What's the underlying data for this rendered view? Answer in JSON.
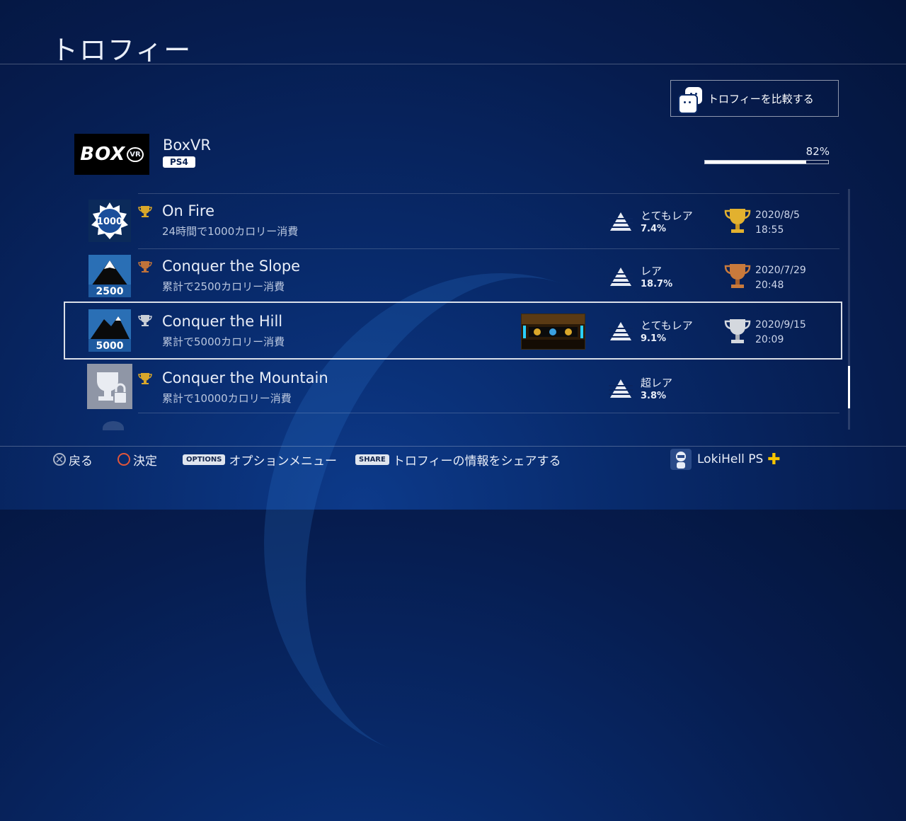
{
  "header": {
    "title": "トロフィー"
  },
  "compare_button": {
    "label": "トロフィーを比較する"
  },
  "game": {
    "logo_text": "BOX",
    "logo_badge": "VR",
    "title": "BoxVR",
    "platform": "PS4",
    "progress_text": "82%",
    "progress": 0.82
  },
  "trophies": [
    {
      "badge": "1000",
      "name": "On Fire",
      "description": "24時間で1000カロリー消費",
      "grade": "gold",
      "rarity_label": "とてもレア",
      "rarity_pct": "7.4%",
      "date": "2020/8/5",
      "time": "18:55",
      "earned": true
    },
    {
      "badge": "2500",
      "name": "Conquer the Slope",
      "description": "累計で2500カロリー消費",
      "grade": "bronze",
      "rarity_label": "レア",
      "rarity_pct": "18.7%",
      "date": "2020/7/29",
      "time": "20:48",
      "earned": true
    },
    {
      "badge": "5000",
      "name": "Conquer the Hill",
      "description": "累計で5000カロリー消費",
      "grade": "silver",
      "rarity_label": "とてもレア",
      "rarity_pct": "9.1%",
      "date": "2020/9/15",
      "time": "20:09",
      "earned": true,
      "selected": true
    },
    {
      "badge": "",
      "name": "Conquer the Mountain",
      "description": "累計で10000カロリー消費",
      "grade": "gold",
      "rarity_label": "超レア",
      "rarity_pct": "3.8%",
      "date": "",
      "time": "",
      "earned": false
    }
  ],
  "footer": {
    "back_label": "戻る",
    "confirm_label": "決定",
    "options_key": "OPTIONS",
    "options_label": "オプションメニュー",
    "share_key": "SHARE",
    "share_label": "トロフィーの情報をシェアする",
    "user_name": "LokiHell PS",
    "plus_icon": "✚"
  },
  "colors": {
    "gold": "#d9a72a",
    "silver": "#c9ced6",
    "bronze": "#c0733a"
  }
}
